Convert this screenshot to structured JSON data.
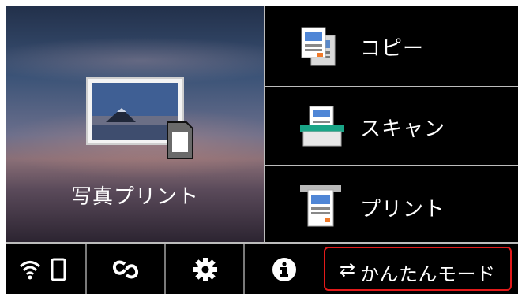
{
  "home": {
    "photo_print_label": "写真プリント",
    "copy_label": "コピー",
    "scan_label": "スキャン",
    "print_label": "プリント"
  },
  "bottom_bar": {
    "wifi_icon": "wifi-icon",
    "phone_icon": "smartphone-icon",
    "link_icon": "wireless-link-icon",
    "settings_icon": "gear-icon",
    "info_icon": "info-icon",
    "easy_mode_arrow": "⇄",
    "easy_mode_label": "かんたんモード"
  },
  "colors": {
    "accent_border": "#e21a1a",
    "background": "#000000",
    "separator": "#bcbcbc"
  }
}
